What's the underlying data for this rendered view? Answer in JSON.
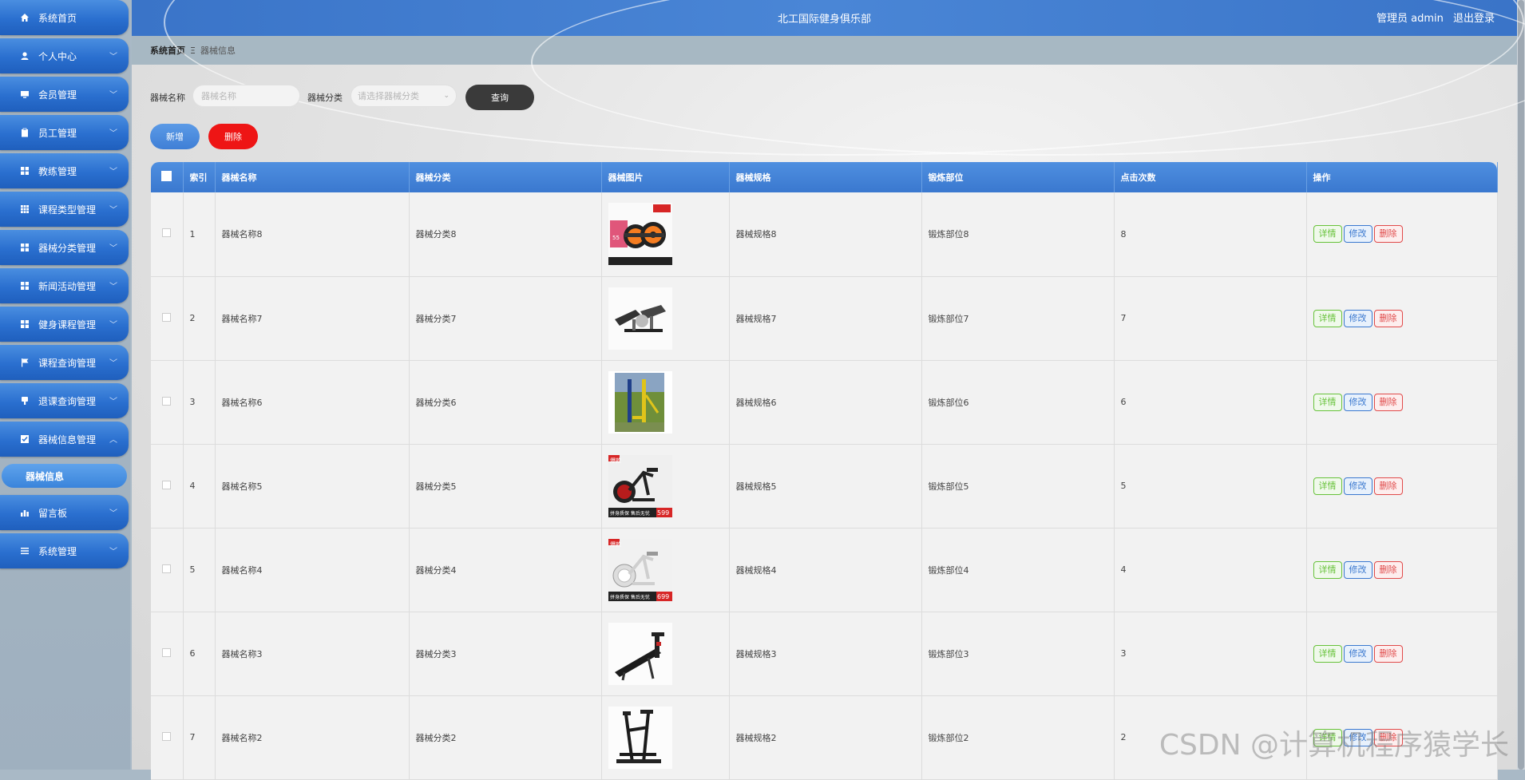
{
  "header": {
    "title": "北工国际健身俱乐部",
    "user_label": "管理员 admin",
    "logout_label": "退出登录"
  },
  "breadcrumb": {
    "home": "系统首页",
    "separator": "Ξ",
    "current": "器械信息"
  },
  "sidebar": {
    "items": [
      {
        "label": "系统首页",
        "icon": "home-icon",
        "has_arrow": false
      },
      {
        "label": "个人中心",
        "icon": "user-icon",
        "has_arrow": true
      },
      {
        "label": "会员管理",
        "icon": "monitor-icon",
        "has_arrow": true
      },
      {
        "label": "员工管理",
        "icon": "clipboard-icon",
        "has_arrow": true
      },
      {
        "label": "教练管理",
        "icon": "grid-icon",
        "has_arrow": true
      },
      {
        "label": "课程类型管理",
        "icon": "grid-9-icon",
        "has_arrow": true
      },
      {
        "label": "器械分类管理",
        "icon": "grid-icon",
        "has_arrow": true
      },
      {
        "label": "新闻活动管理",
        "icon": "grid-icon",
        "has_arrow": true
      },
      {
        "label": "健身课程管理",
        "icon": "grid-icon",
        "has_arrow": true
      },
      {
        "label": "课程查询管理",
        "icon": "flag-icon",
        "has_arrow": true
      },
      {
        "label": "退课查询管理",
        "icon": "thumbs-down-icon",
        "has_arrow": true
      },
      {
        "label": "器械信息管理",
        "icon": "checkbox-icon",
        "has_arrow": true,
        "expanded": true
      },
      {
        "label": "留言板",
        "icon": "chart-icon",
        "has_arrow": true
      },
      {
        "label": "系统管理",
        "icon": "list-icon",
        "has_arrow": true
      }
    ],
    "sub_item": {
      "label": "器械信息"
    }
  },
  "search": {
    "name_label": "器械名称",
    "name_placeholder": "器械名称",
    "category_label": "器械分类",
    "category_placeholder": "请选择器械分类",
    "query_button": "查询"
  },
  "actions": {
    "add_button": "新增",
    "delete_button": "删除"
  },
  "table": {
    "columns": [
      "索引",
      "器械名称",
      "器械分类",
      "器械图片",
      "器械规格",
      "锻炼部位",
      "点击次数",
      "操作"
    ],
    "row_actions": {
      "detail": "详情",
      "edit": "修改",
      "delete": "删除"
    },
    "rows": [
      {
        "index": "1",
        "name": "器械名称8",
        "category": "器械分类8",
        "image": "ab-roller",
        "spec": "器械规格8",
        "part": "锻炼部位8",
        "clicks": "8"
      },
      {
        "index": "2",
        "name": "器械名称7",
        "category": "器械分类7",
        "image": "stepper",
        "spec": "器械规格7",
        "part": "锻炼部位7",
        "clicks": "7"
      },
      {
        "index": "3",
        "name": "器械名称6",
        "category": "器械分类6",
        "image": "outdoor-machine",
        "spec": "器械规格6",
        "part": "锻炼部位6",
        "clicks": "6"
      },
      {
        "index": "4",
        "name": "器械名称5",
        "category": "器械分类5",
        "image": "spin-bike-black",
        "spec": "器械规格5",
        "part": "锻炼部位5",
        "clicks": "5"
      },
      {
        "index": "5",
        "name": "器械名称4",
        "category": "器械分类4",
        "image": "spin-bike-white",
        "spec": "器械规格4",
        "part": "锻炼部位4",
        "clicks": "4"
      },
      {
        "index": "6",
        "name": "器械名称3",
        "category": "器械分类3",
        "image": "sit-up-bench",
        "spec": "器械规格3",
        "part": "锻炼部位3",
        "clicks": "3"
      },
      {
        "index": "7",
        "name": "器械名称2",
        "category": "器械分类2",
        "image": "ab-machine",
        "spec": "器械规格2",
        "part": "锻炼部位2",
        "clicks": "2"
      }
    ]
  },
  "image_texts": {
    "tag_hot": "爆款",
    "price_599": "599",
    "price_699": "699",
    "caption": "拼身质保 售后无忧"
  },
  "watermark": "CSDN @计算机程序猿学长"
}
